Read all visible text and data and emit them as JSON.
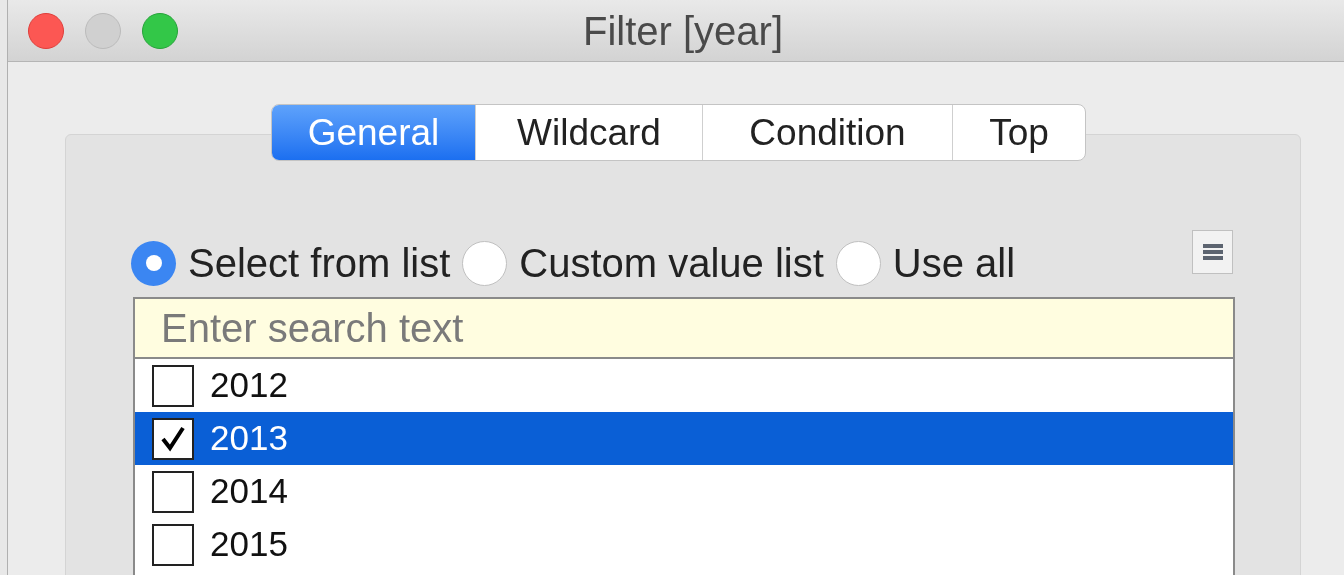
{
  "window": {
    "title": "Filter [year]"
  },
  "tabs": [
    {
      "label": "General",
      "selected": true
    },
    {
      "label": "Wildcard",
      "selected": false
    },
    {
      "label": "Condition",
      "selected": false
    },
    {
      "label": "Top",
      "selected": false
    }
  ],
  "options": [
    {
      "label": "Select from list",
      "selected": true
    },
    {
      "label": "Custom value list",
      "selected": false
    },
    {
      "label": "Use all",
      "selected": false
    }
  ],
  "search": {
    "placeholder": "Enter search text"
  },
  "items": [
    {
      "label": "2012",
      "checked": false,
      "selected": false
    },
    {
      "label": "2013",
      "checked": true,
      "selected": true
    },
    {
      "label": "2014",
      "checked": false,
      "selected": false
    },
    {
      "label": "2015",
      "checked": false,
      "selected": false
    }
  ]
}
